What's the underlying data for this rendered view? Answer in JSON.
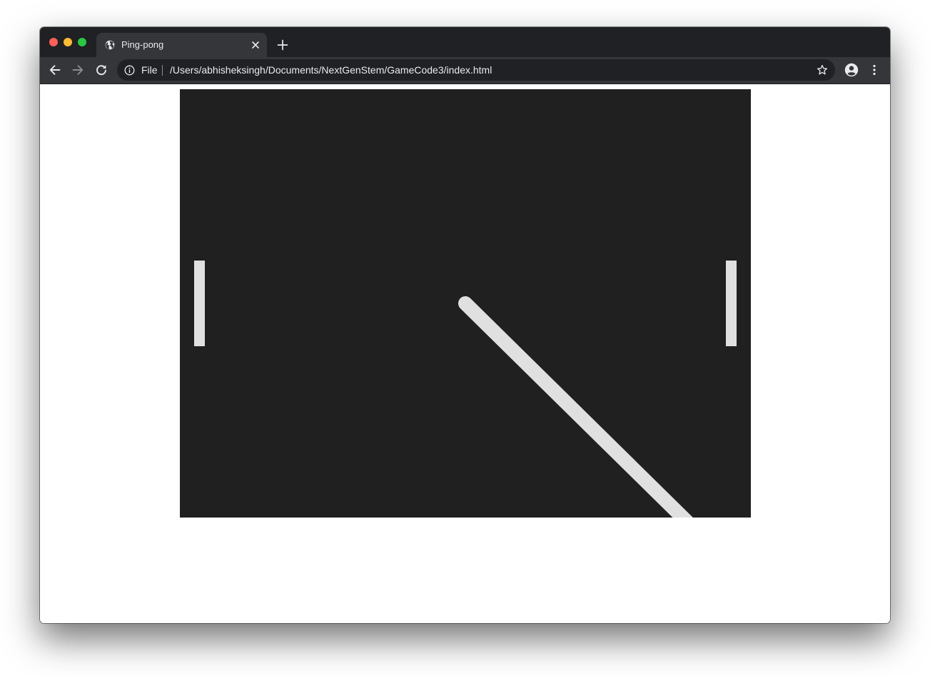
{
  "window": {
    "controls": {
      "close_color": "#ff5f57",
      "minimize_color": "#febc2e",
      "maximize_color": "#28c840"
    }
  },
  "tab": {
    "title": "Ping-pong",
    "favicon": "globe-icon"
  },
  "toolbar": {
    "back_icon": "arrow-left-icon",
    "forward_icon": "arrow-right-icon",
    "reload_icon": "reload-icon",
    "profile_icon": "account-circle-icon",
    "menu_icon": "more-vert-icon"
  },
  "address_bar": {
    "scheme_label": "File",
    "url": "/Users/abhisheksingh/Documents/NextGenStem/GameCode3/index.html",
    "bookmark_icon": "star-icon"
  },
  "game": {
    "background_color": "#202020",
    "foreground_color": "#e0e0e0"
  }
}
